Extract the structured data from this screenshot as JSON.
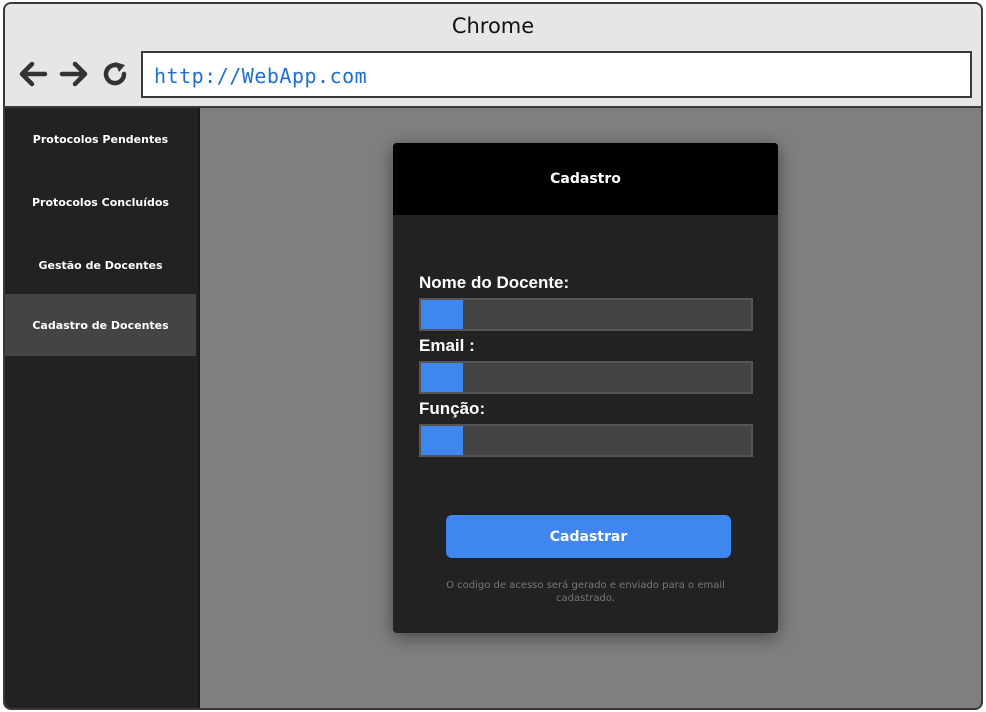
{
  "window": {
    "title": "Chrome"
  },
  "browser": {
    "url": "http://WebApp.com",
    "icons": [
      "back-arrow-icon",
      "forward-arrow-icon",
      "reload-icon"
    ]
  },
  "sidebar": {
    "items": [
      {
        "label": "Protocolos Pendentes",
        "active": false
      },
      {
        "label": "Protocolos Concluídos",
        "active": false
      },
      {
        "label": "Gestão de Docentes",
        "active": false
      },
      {
        "label": "Cadastro de Docentes",
        "active": true
      }
    ]
  },
  "form": {
    "title": "Cadastro",
    "fields": [
      {
        "label": "Nome do Docente:",
        "value": ""
      },
      {
        "label": "Email :",
        "value": ""
      },
      {
        "label": "Função:",
        "value": ""
      }
    ],
    "submit_label": "Cadastrar",
    "note": "O codigo de acesso será gerado e enviado para o email cadastrado."
  },
  "colors": {
    "accent": "#3f86ef",
    "sidebar_bg": "#222222",
    "sidebar_active_bg": "#444444",
    "content_bg": "#7f7f7f",
    "card_header_bg": "#000000",
    "url_text": "#1f6fd1"
  }
}
